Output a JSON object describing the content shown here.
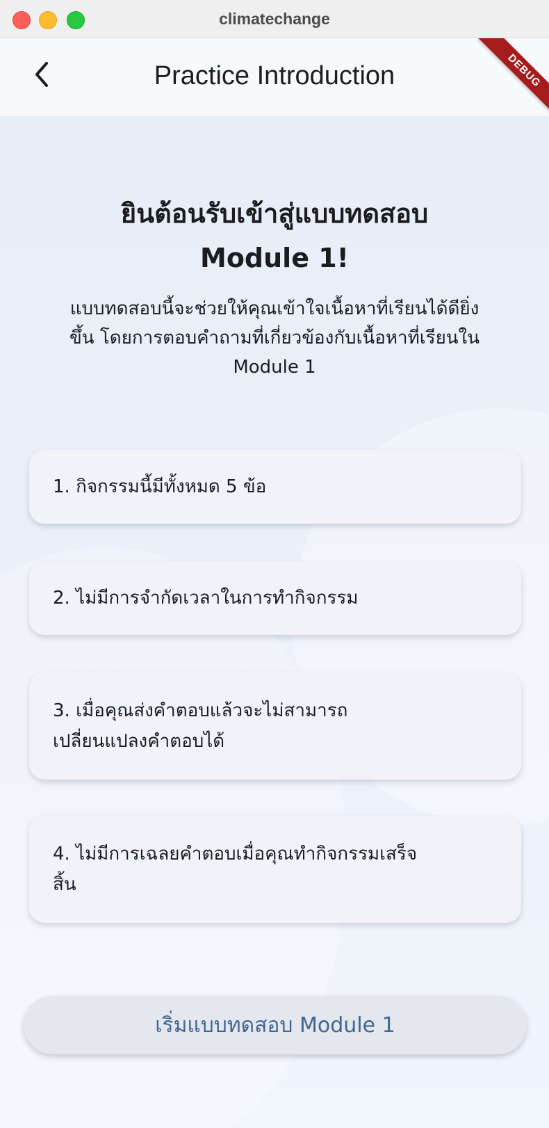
{
  "window": {
    "title": "climatechange"
  },
  "appbar": {
    "title": "Practice Introduction",
    "debug_banner": "DEBUG"
  },
  "icons": {
    "back": "chevron-left-icon"
  },
  "main": {
    "heading_line1": "ยินต้อนรับเข้าสู่แบบทดสอบ",
    "heading_line2": "Module 1!",
    "intro_line1": "แบบทดสอบนี้จะช่วยให้คุณเข้าใจเนื้อหาที่เรียนได้ดียิ่ง",
    "intro_line2": "ขึ้น โดยการตอบคำถามที่เกี่ยวข้องกับเนื้อหาที่เรียนใน",
    "intro_line3": "Module 1",
    "rules": [
      {
        "line1": "1. กิจกรรมนี้มีทั้งหมด 5 ข้อ",
        "line2": ""
      },
      {
        "line1": "2. ไม่มีการจำกัดเวลาในการทำกิจกรรม",
        "line2": ""
      },
      {
        "line1": "3. เมื่อคุณส่งคำตอบแล้วจะไม่สามารถ",
        "line2": "เปลี่ยนแปลงคำตอบได้"
      },
      {
        "line1": "4. ไม่มีการเฉลยคำตอบเมื่อคุณทำกิจกรรมเสร็จ",
        "line2": "สิ้น"
      }
    ],
    "start_button_label": "เริ่มแบบทดสอบ Module 1"
  },
  "colors": {
    "accent": "#3f6690",
    "debug_ribbon": "#a61b1b",
    "card_bg": "#f2f3f8"
  }
}
